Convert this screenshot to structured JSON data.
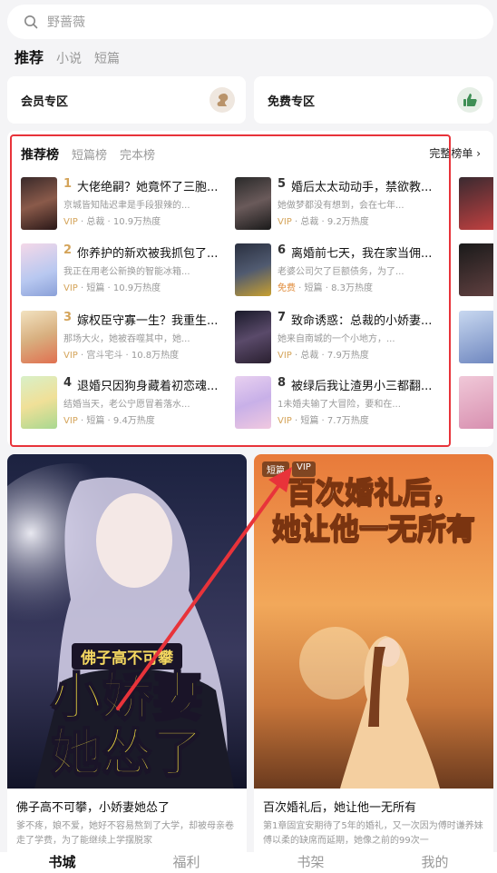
{
  "search": {
    "placeholder": "野蔷薇"
  },
  "tabs": [
    "推荐",
    "小说",
    "短篇"
  ],
  "zones": [
    {
      "label": "会员专区",
      "icon": "squirrel-icon"
    },
    {
      "label": "免费专区",
      "icon": "thumbs-up-icon"
    }
  ],
  "ranking": {
    "tabs": [
      "推荐榜",
      "短篇榜",
      "完本榜"
    ],
    "full_label": "完整榜单 ›",
    "items": [
      {
        "rank": "1",
        "title": "大佬绝嗣？她竟怀了三胞...",
        "desc": "京城皆知陆迟聿是手段狠辣的...",
        "tag": "VIP",
        "meta": " · 总裁 · 10.9万热度"
      },
      {
        "rank": "2",
        "title": "你养护的新欢被我抓包了...",
        "desc": "我正在用老公新换的智能冰箱...",
        "tag": "VIP",
        "meta": " · 短篇 · 10.9万热度"
      },
      {
        "rank": "3",
        "title": "嫁权臣守寡一生？我重生...",
        "desc": "那场大火，她被吞噬其中，她...",
        "tag": "VIP",
        "meta": " · 宫斗宅斗 · 10.8万热度"
      },
      {
        "rank": "4",
        "title": "退婚只因狗身藏着初恋魂...",
        "desc": "结婚当天，老公宁愿冒着落水...",
        "tag": "VIP",
        "meta": " · 短篇 · 9.4万热度"
      },
      {
        "rank": "5",
        "title": "婚后太太动动手，禁欲教...",
        "desc": "她做梦都没有想到，会在七年...",
        "tag": "VIP",
        "meta": " · 总裁 · 9.2万热度"
      },
      {
        "rank": "6",
        "title": "离婚前七天，我在家当佣...",
        "desc": "老婆公司欠了巨额债务，为了...",
        "tag": "免费",
        "meta": " · 短篇 · 8.3万热度"
      },
      {
        "rank": "7",
        "title": "致命诱惑：总裁的小娇妻...",
        "desc": "她来自南城的一个小地方，...",
        "tag": "VIP",
        "meta": " · 总裁 · 7.9万热度"
      },
      {
        "rank": "8",
        "title": "被绿后我让渣男小三都翻...",
        "desc": "1未婚夫输了大冒险，要和在...",
        "tag": "VIP",
        "meta": " · 短篇 · 7.7万热度"
      }
    ]
  },
  "cards": [
    {
      "title": "佛子高不可攀，小娇妻她怂了",
      "desc": "爹不疼，娘不爱，她好不容易熬到了大学，却被母亲卷走了学费，为了能继续上学摆脱家",
      "poster_top": "佛子高不可攀",
      "poster_main1": "小娇妻",
      "poster_main2": "她怂了",
      "badges": []
    },
    {
      "title": "百次婚礼后，她让他一无所有",
      "desc": "第1章固宜安期待了5年的婚礼，又一次因为傅时谦养妹傅以柔的缺席而延期，她像之前的99次一",
      "poster_line1": "百次婚礼后，",
      "poster_line2": "她让他一无所有",
      "badges": [
        "短篇",
        "VIP"
      ]
    }
  ],
  "bottom_nav": [
    "书城",
    "福利",
    "书架",
    "我的"
  ],
  "colors": {
    "accent_gold": "#d4a45a",
    "highlight_red": "#e8333a"
  }
}
